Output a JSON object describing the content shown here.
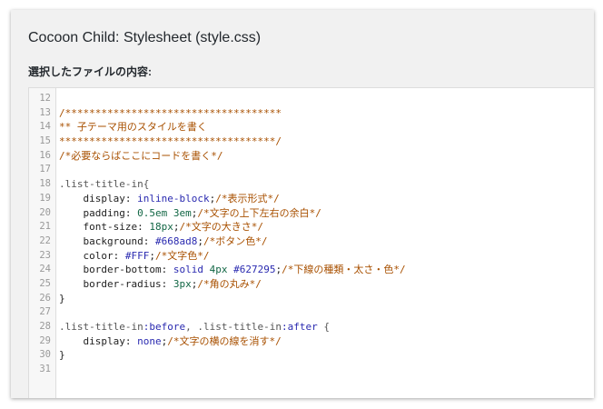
{
  "header": {
    "title": "Cocoon Child: Stylesheet (style.css)",
    "subtitle": "選択したファイルの内容:"
  },
  "editor": {
    "lines": [
      {
        "n": "12",
        "tokens": []
      },
      {
        "n": "13",
        "tokens": [
          {
            "t": "/************************************",
            "c": "comment"
          }
        ]
      },
      {
        "n": "14",
        "tokens": [
          {
            "t": "** 子テーマ用のスタイルを書く",
            "c": "comment"
          }
        ]
      },
      {
        "n": "15",
        "tokens": [
          {
            "t": "************************************/",
            "c": "comment"
          }
        ]
      },
      {
        "n": "16",
        "tokens": [
          {
            "t": "/*必要ならばここにコードを書く*/",
            "c": "comment"
          }
        ]
      },
      {
        "n": "17",
        "tokens": []
      },
      {
        "n": "18",
        "tokens": [
          {
            "t": ".list-title-in{",
            "c": "sel"
          }
        ]
      },
      {
        "n": "19",
        "tokens": [
          {
            "t": "    display: ",
            "c": "prop"
          },
          {
            "t": "inline-block",
            "c": "kw"
          },
          {
            "t": ";",
            "c": "prop"
          },
          {
            "t": "/*表示形式*/",
            "c": "comment"
          }
        ]
      },
      {
        "n": "20",
        "tokens": [
          {
            "t": "    padding: ",
            "c": "prop"
          },
          {
            "t": "0.5em 3em",
            "c": "num"
          },
          {
            "t": ";",
            "c": "prop"
          },
          {
            "t": "/*文字の上下左右の余白*/",
            "c": "comment"
          }
        ]
      },
      {
        "n": "21",
        "tokens": [
          {
            "t": "    font-size: ",
            "c": "prop"
          },
          {
            "t": "18px",
            "c": "num"
          },
          {
            "t": ";",
            "c": "prop"
          },
          {
            "t": "/*文字の大きさ*/",
            "c": "comment"
          }
        ]
      },
      {
        "n": "22",
        "tokens": [
          {
            "t": "    background: ",
            "c": "prop"
          },
          {
            "t": "#668ad8",
            "c": "hex"
          },
          {
            "t": ";",
            "c": "prop"
          },
          {
            "t": "/*ボタン色*/",
            "c": "comment"
          }
        ]
      },
      {
        "n": "23",
        "tokens": [
          {
            "t": "    color: ",
            "c": "prop"
          },
          {
            "t": "#FFF",
            "c": "hex"
          },
          {
            "t": ";",
            "c": "prop"
          },
          {
            "t": "/*文字色*/",
            "c": "comment"
          }
        ]
      },
      {
        "n": "24",
        "tokens": [
          {
            "t": "    border-bottom: ",
            "c": "prop"
          },
          {
            "t": "solid ",
            "c": "kw"
          },
          {
            "t": "4px ",
            "c": "num"
          },
          {
            "t": "#627295",
            "c": "hex"
          },
          {
            "t": ";",
            "c": "prop"
          },
          {
            "t": "/*下線の種類・太さ・色*/",
            "c": "comment"
          }
        ]
      },
      {
        "n": "25",
        "tokens": [
          {
            "t": "    border-radius: ",
            "c": "prop"
          },
          {
            "t": "3px",
            "c": "num"
          },
          {
            "t": ";",
            "c": "prop"
          },
          {
            "t": "/*角の丸み*/",
            "c": "comment"
          }
        ]
      },
      {
        "n": "26",
        "tokens": [
          {
            "t": "}",
            "c": "prop"
          }
        ]
      },
      {
        "n": "27",
        "tokens": []
      },
      {
        "n": "28",
        "tokens": [
          {
            "t": ".list-title-in",
            "c": "sel"
          },
          {
            "t": ":before",
            "c": "pseudo"
          },
          {
            "t": ", .list-title-in",
            "c": "sel"
          },
          {
            "t": ":after",
            "c": "pseudo"
          },
          {
            "t": " {",
            "c": "sel"
          }
        ]
      },
      {
        "n": "29",
        "tokens": [
          {
            "t": "    display: ",
            "c": "prop"
          },
          {
            "t": "none",
            "c": "kw"
          },
          {
            "t": ";",
            "c": "prop"
          },
          {
            "t": "/*文字の横の線を消す*/",
            "c": "comment"
          }
        ]
      },
      {
        "n": "30",
        "tokens": [
          {
            "t": "}",
            "c": "prop"
          }
        ]
      },
      {
        "n": "31",
        "tokens": []
      }
    ]
  }
}
